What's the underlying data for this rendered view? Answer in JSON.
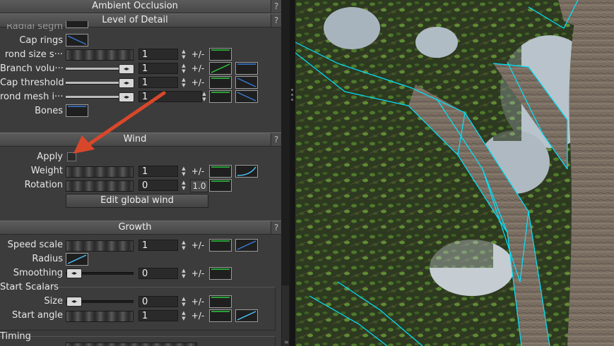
{
  "sections": {
    "ambient_occlusion": "Ambient Occlusion",
    "level_of_detail": "Level of Detail",
    "wind": "Wind",
    "growth": "Growth",
    "help": "?"
  },
  "lod": {
    "cutoff_label": "Radial segm",
    "cap_rings": "Cap rings",
    "frond_size": "rond size s···",
    "frond_size_value": "1",
    "branch_volume": "Branch volu···",
    "branch_volume_value": "1",
    "cap_threshold": "Cap threshold",
    "cap_threshold_value": "1",
    "frond_mesh": "rond mesh i···",
    "frond_mesh_value": "1",
    "bones": "Bones"
  },
  "wind": {
    "apply": "Apply",
    "weight": "Weight",
    "weight_value": "1",
    "rotation": "Rotation",
    "rotation_value": "0",
    "rotation_scale": "1.0",
    "edit_global_wind": "Edit global wind"
  },
  "growth": {
    "speed_scale": "Speed scale",
    "speed_scale_value": "1",
    "radius": "Radius",
    "smoothing": "Smoothing",
    "smoothing_value": "0",
    "start_scalars": "Start Scalars",
    "size": "Size",
    "size_value": "0",
    "start_angle": "Start angle",
    "start_angle_value": "1",
    "timing": "Timing"
  },
  "controls": {
    "plus_minus": "+/-",
    "spin_up": "▲",
    "spin_down": "▼",
    "knob_glyph": "◂▸"
  },
  "colors": {
    "curve_green": "#2ecc40",
    "curve_blue": "#3a7bd5",
    "curve_cyan": "#4fc3f7",
    "annotation_arrow": "#d9472b",
    "wireframe": "#00e5ff"
  },
  "icons": {
    "help": "question-icon",
    "arrow": "annotation-arrow-icon"
  }
}
